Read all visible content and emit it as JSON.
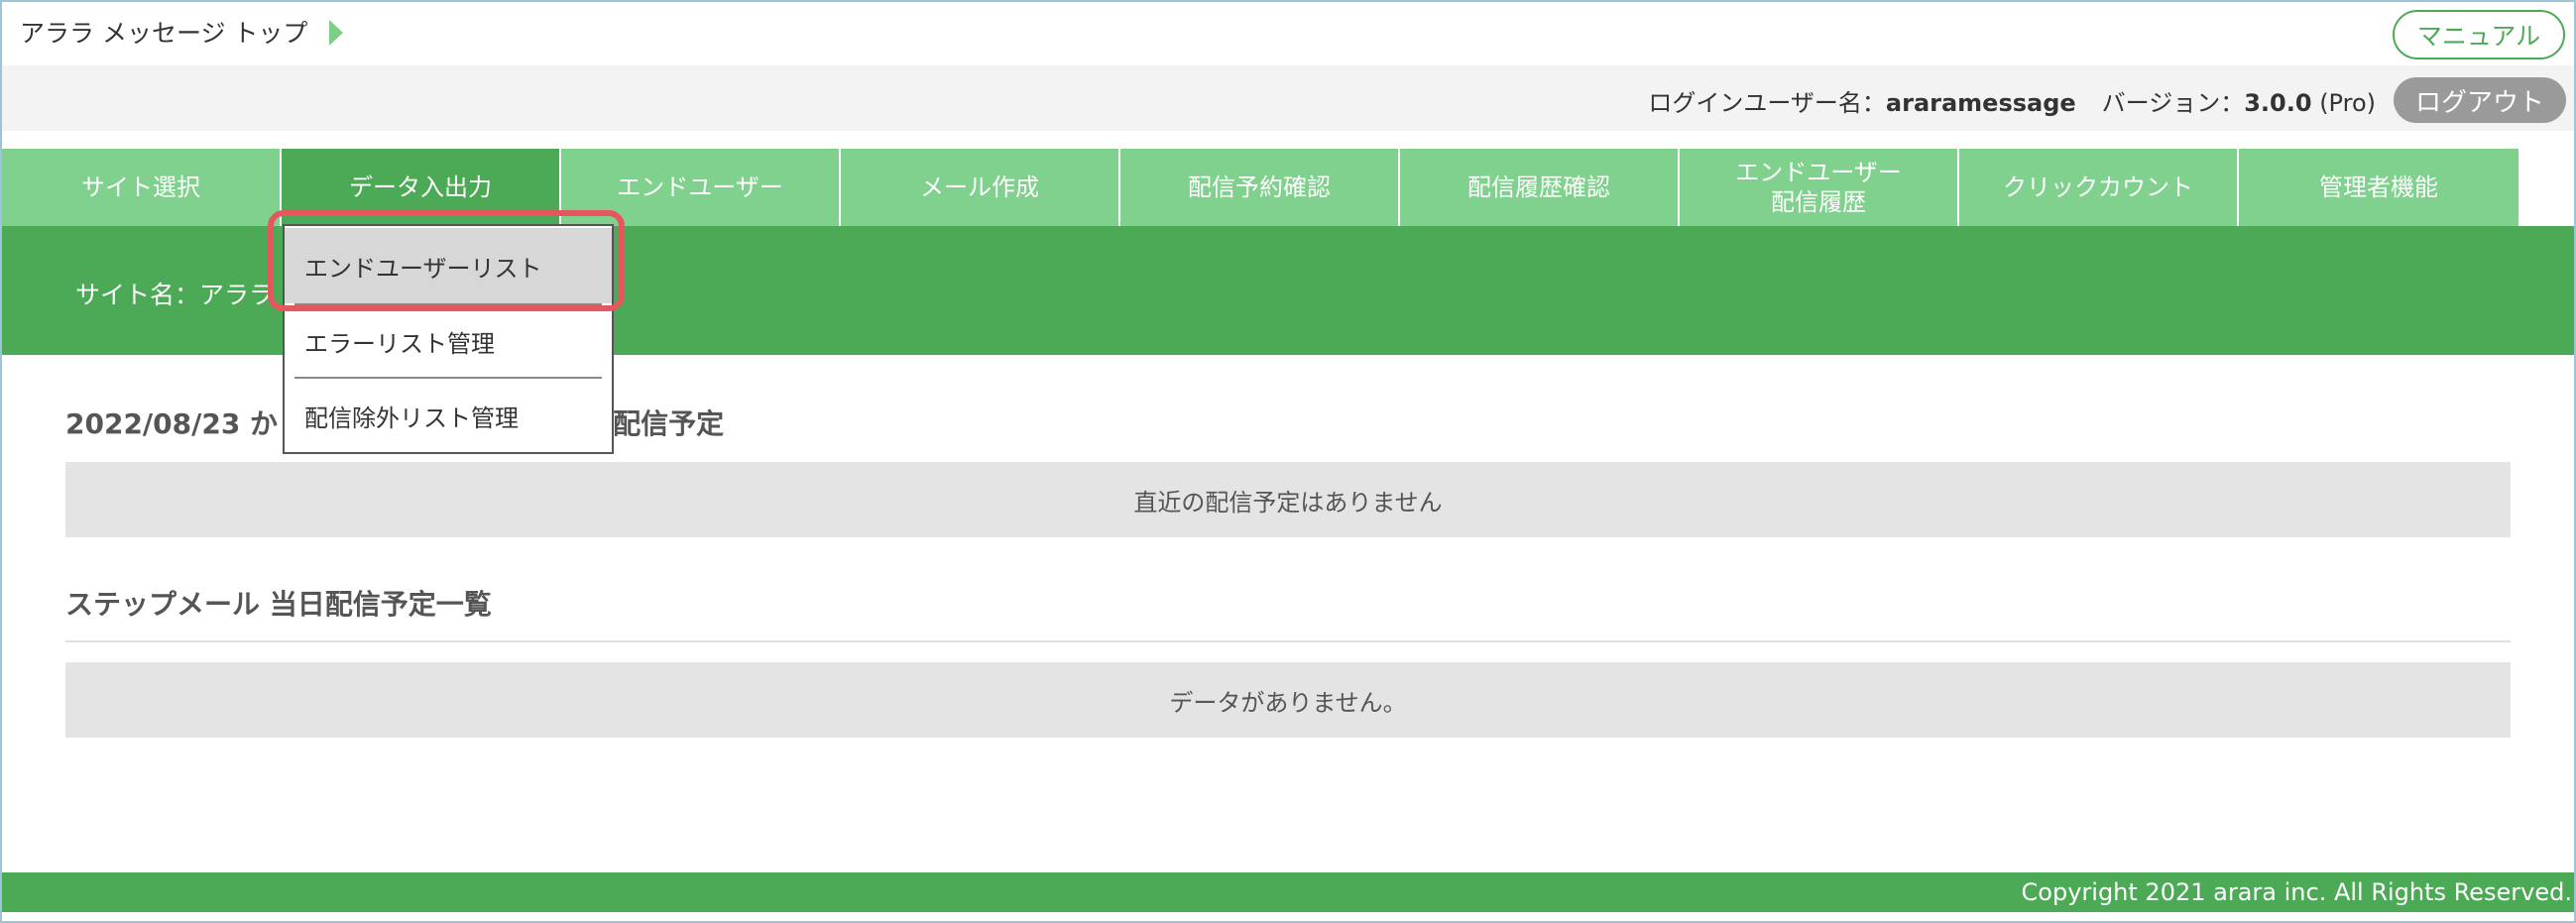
{
  "header": {
    "breadcrumb": "アララ メッセージ トップ",
    "manual_label": "マニュアル"
  },
  "userbar": {
    "user_label": "ログインユーザー名：",
    "user_name": "araramessage",
    "version_label": "バージョン：",
    "version": "3.0.0",
    "edition": "(Pro)",
    "logout_label": "ログアウト"
  },
  "tabs": [
    {
      "label": "サイト選択"
    },
    {
      "label": "データ入出力"
    },
    {
      "label": "エンドユーザー"
    },
    {
      "label": "メール作成"
    },
    {
      "label": "配信予約確認"
    },
    {
      "label": "配信履歴確認"
    },
    {
      "label_line1": "エンドユーザー",
      "label_line2": "配信履歴"
    },
    {
      "label": "クリックカウント"
    },
    {
      "label": "管理者機能"
    }
  ],
  "site": {
    "name_label": "サイト名：アララ メ"
  },
  "schedule": {
    "title_start": "2022/08/23 か",
    "title_end": "配信予定",
    "empty_text": "直近の配信予定はありません"
  },
  "stepmail": {
    "title": "ステップメール 当日配信予定一覧",
    "empty_text": "データがありません。"
  },
  "dropdown": {
    "items": [
      {
        "label": "エンドユーザーリスト"
      },
      {
        "label": "エラーリスト管理"
      },
      {
        "label": "配信除外リスト管理"
      }
    ],
    "highlight_color": "#e4575c"
  },
  "footer": {
    "copyright": "Copyright 2021 arara inc. All Rights Reserved."
  },
  "colors": {
    "accent_green": "#4caa56",
    "tab_green": "#80d18e"
  }
}
